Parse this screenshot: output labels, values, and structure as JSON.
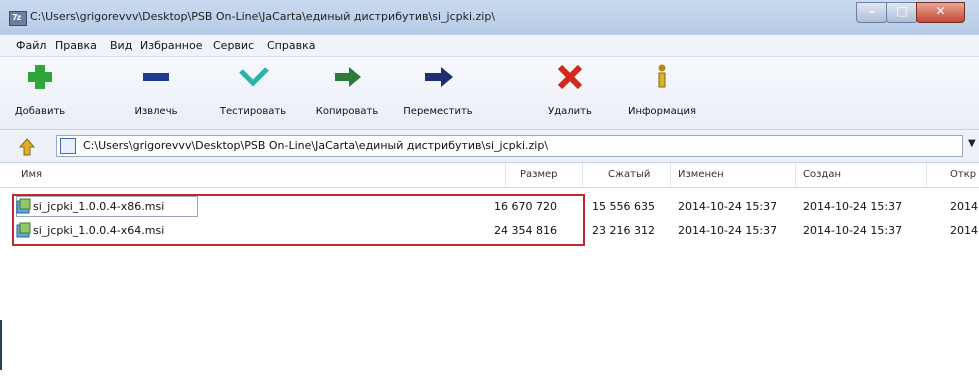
{
  "window": {
    "title": "C:\\Users\\grigorevvv\\Desktop\\PSB On-Line\\JaCarta\\единый дистрибутив\\si_jcpki.zip\\"
  },
  "menu": [
    "Файл",
    "Правка",
    "Вид",
    "Избранное",
    "Сервис",
    "Справка"
  ],
  "toolbar": [
    {
      "label": "Добавить",
      "icon": "add-plus-icon"
    },
    {
      "label": "Извлечь",
      "icon": "extract-minus-icon"
    },
    {
      "label": "Тестировать",
      "icon": "test-check-icon"
    },
    {
      "label": "Копировать",
      "icon": "copy-arrow-icon"
    },
    {
      "label": "Переместить",
      "icon": "move-arrow-icon"
    },
    {
      "label": "Удалить",
      "icon": "delete-x-icon"
    },
    {
      "label": "Информация",
      "icon": "info-icon"
    }
  ],
  "address": {
    "path": "C:\\Users\\grigorevvv\\Desktop\\PSB On-Line\\JaCarta\\единый дистрибутив\\si_jcpki.zip\\"
  },
  "columns": [
    "Имя",
    "Размер",
    "Сжатый",
    "Изменен",
    "Создан",
    "Откр"
  ],
  "files": [
    {
      "name": "si_jcpki_1.0.0.4-x86.msi",
      "size": "16 670 720",
      "packed": "15 556 635",
      "modified": "2014-10-24 15:37",
      "created": "2014-10-24 15:37",
      "opened": "2014"
    },
    {
      "name": "si_jcpki_1.0.0.4-x64.msi",
      "size": "24 354 816",
      "packed": "23 216 312",
      "modified": "2014-10-24 15:37",
      "created": "2014-10-24 15:37",
      "opened": "2014"
    }
  ],
  "colors": {
    "highlight": "#c1272d",
    "add": "#2ea63a",
    "delete": "#d02a1e",
    "move": "#1d2f6e"
  }
}
